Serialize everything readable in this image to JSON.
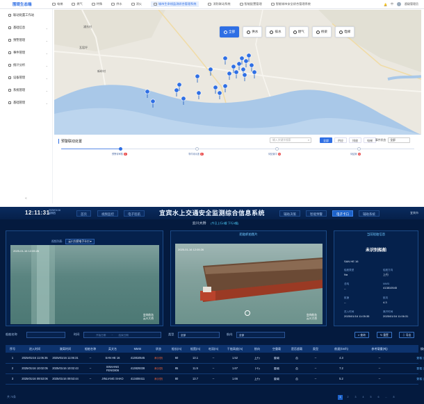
{
  "top": {
    "logo": "围堤生态端",
    "tabs": [
      "电梯",
      "燃气",
      "特殊",
      "供水",
      "消火",
      "城市生命线监测综合管理系统",
      "消防联动系统",
      "智能配置管理",
      "智能城市安全综合管理系统"
    ],
    "active_tab_index": 5,
    "right_items": [
      "中",
      "超级管理员"
    ],
    "sidebar": [
      {
        "label": "联动处置工作站"
      },
      {
        "label": "基础信息"
      },
      {
        "label": "预警管理"
      },
      {
        "label": "事件管理"
      },
      {
        "label": "统计分析"
      },
      {
        "label": "设备管理"
      },
      {
        "label": "系统管理"
      },
      {
        "label": "基础管理"
      }
    ],
    "map": {
      "layers": [
        {
          "label": "全部",
          "icon": "grid-icon",
          "active": true
        },
        {
          "label": "供水",
          "icon": "water-icon",
          "active": false
        },
        {
          "label": "排水",
          "icon": "drain-icon",
          "active": false
        },
        {
          "label": "燃气",
          "icon": "gas-icon",
          "active": false
        },
        {
          "label": "桥梁",
          "icon": "bridge-icon",
          "active": false
        },
        {
          "label": "电梯",
          "icon": "elevator-icon",
          "active": false
        }
      ],
      "place_labels": [
        "浦东村",
        "瓦窑坪",
        "新岭村"
      ]
    },
    "timeline": {
      "title": "预警联动处置",
      "search_placeholder": "输入关键字搜索",
      "tabs": [
        "全部",
        "供应",
        "排放",
        "电梯"
      ],
      "active_tab": 0,
      "filter_label": "事件状态",
      "filter_value": "全部",
      "nodes": [
        {
          "label": "预警待审核",
          "badge": "0",
          "active": true
        },
        {
          "label": "事件待派遣",
          "badge": "0",
          "active": false
        },
        {
          "label": "待处置中",
          "badge": "0",
          "active": false
        },
        {
          "label": "待结案",
          "badge": "0",
          "active": false
        }
      ]
    }
  },
  "bottom": {
    "clock": "12:11:31",
    "date": "2025/01/16",
    "weekday": "星期四",
    "title": "宜宾水上交通安全监测综合信息系统",
    "left_tabs": [
      "首页",
      "视频监控",
      "电子巡航"
    ],
    "right_tabs": [
      "辅助决策",
      "智能预警",
      "电子卡口",
      "辅助系统"
    ],
    "active_right_tab": 2,
    "user": "宜宾市",
    "location": "云川大桥",
    "status": "(今日上行0艘 下行0艘)",
    "panels": {
      "cam_select_label": "视频列表:",
      "cam_select_value": "云川大桥电子卡口",
      "cam1_ts": "2025-01-16 12:05:26",
      "cam1_wm": [
        "宜宾航务",
        "云川大桥"
      ],
      "cam2_title": "船舶抓拍图片",
      "cam2_ts": "2025-01-16 12:05:26",
      "cam2_wm": [
        "宜宾航务",
        "云川大桥"
      ],
      "info_title": "当前船舶信息",
      "ship_name": "未识别船舶",
      "ship_en": "SAN HE 16",
      "fields": [
        {
          "label": "船舶类型",
          "value": "Na"
        },
        {
          "label": "船舶方向",
          "value": "上行"
        },
        {
          "label": "总吨",
          "value": "--"
        },
        {
          "label": "MMSI",
          "value": "413810545"
        },
        {
          "label": "航速",
          "value": "--"
        },
        {
          "label": "航向",
          "value": "4.3"
        },
        {
          "label": "进入时间",
          "value": "2025/01/16 11:05:35"
        },
        {
          "label": "离开时间",
          "value": "2025/01/16 11:06:31"
        }
      ]
    },
    "filters": {
      "ship_label": "船舶名称",
      "time_label": "时间",
      "time_start": "开始日期",
      "time_end": "结束日期",
      "type_label": "类型",
      "type_value": "全部",
      "dir_label": "航向",
      "dir_value": "全部",
      "btn_query": "查询",
      "btn_reset": "重置",
      "btn_export": "导出"
    },
    "columns": [
      "序号",
      "进入时间",
      "驶离时间",
      "船舶名称",
      "英文名",
      "MMSI",
      "状态",
      "船长(m)",
      "船宽(m)",
      "吃深(m)",
      "干舷高度(m)",
      "航向",
      "空重载",
      "是否超载",
      "类型",
      "航速(km/h)",
      "参考载重(吨)",
      "操作"
    ],
    "rows": [
      [
        "1",
        "2025/01/16 11:05:35",
        "2025/01/16 11:06:31",
        "--",
        "SAN HE 16",
        "413810545",
        "未识别",
        "60",
        "13.1",
        "--",
        "1.52",
        "上行",
        "重载",
        "否",
        "--",
        "4.3",
        "--",
        "查看 | 删除"
      ],
      [
        "2",
        "2025/01/16 10:02:05",
        "2025/01/16 10:02:43",
        "--",
        "XINHANG FENG806",
        "413829338",
        "未识别",
        "85",
        "11.9",
        "--",
        "1.67",
        "下行",
        "重载",
        "否",
        "--",
        "7.2",
        "--",
        "查看 | 删除"
      ],
      [
        "3",
        "2025/01/16 09:53:06",
        "2025/01/16 09:53:44",
        "--",
        "JINLIANG SHAO",
        "413408411",
        "未识别",
        "80",
        "13.7",
        "--",
        "1.66",
        "上行",
        "重载",
        "否",
        "--",
        "5.2",
        "--",
        "查看 | 删除"
      ]
    ],
    "pager": {
      "total": "共 75条",
      "pages": [
        "1",
        "2",
        "3",
        "4",
        "5",
        "6",
        "...",
        "8"
      ],
      "active_page": "1"
    }
  },
  "colors": {
    "accent": "#2f6fe4",
    "alert": "#e94b4b",
    "dark_bg": "#041a3e",
    "unrecognized": "#ff6a3d",
    "link": "#5fb4ff"
  }
}
